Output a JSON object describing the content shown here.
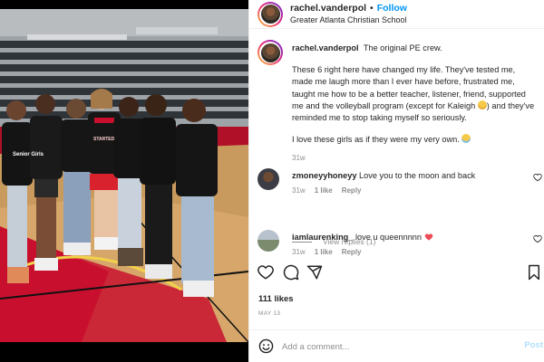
{
  "header": {
    "username": "rachel.vanderpol",
    "separator": "•",
    "follow_label": "Follow",
    "location": "Greater Atlanta Christian School"
  },
  "caption": {
    "username": "rachel.vanderpol",
    "line1": "The original PE crew.",
    "para2": "These 6 right here have changed my life. They've tested me, made me laugh more than I ever have before, frustrated me, taught me how to be a better teacher, listener, friend, supported me and the volleyball program (except for Kaleigh",
    "para2_end": ") and they've reminded me to stop taking myself so seriously.",
    "para3": "I love these girls as if they were my very own.",
    "time_ago": "31w"
  },
  "comments": [
    {
      "username": "zmoneyyhoneyy",
      "text": "Love you to the moon and back",
      "time_ago": "31w",
      "likes": "1 like",
      "reply": "Reply",
      "view_replies": "View replies (1)"
    },
    {
      "username": "iamlaurenking_",
      "text": "love u queennnnn",
      "time_ago": "31w",
      "likes": "1 like",
      "reply": "Reply"
    }
  ],
  "photo": {
    "shirt_text_1": "Senior Girls",
    "shirt_text_2": "STARTED"
  },
  "post": {
    "likes_count": "111 likes",
    "date": "MAY 13"
  },
  "composer": {
    "placeholder": "Add a comment...",
    "post_label": "Post"
  },
  "colors": {
    "accent_blue": "#0095f6",
    "post_disabled": "#b2dffc",
    "heart_red": "#ed4956",
    "muted": "#8e8e8e",
    "court_red": "#c8102e",
    "court_wood": "#c99a5e"
  },
  "icons": [
    "heart-icon",
    "comment-icon",
    "share-icon",
    "bookmark-icon",
    "emoji-icon"
  ]
}
